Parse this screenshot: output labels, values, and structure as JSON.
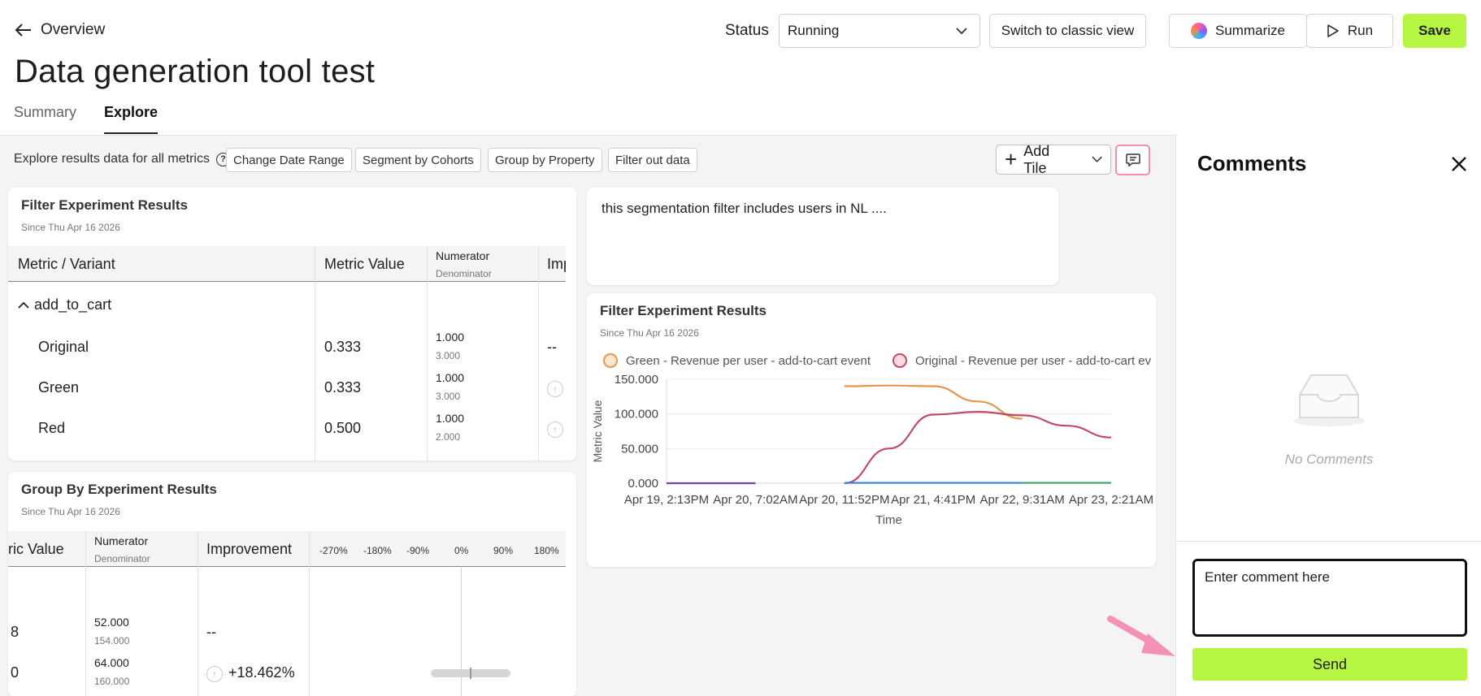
{
  "header": {
    "back_label": "Overview",
    "title": "Data generation tool test",
    "tabs": [
      {
        "label": "Summary"
      },
      {
        "label": "Explore"
      }
    ],
    "status_label": "Status",
    "status_value": "Running",
    "switch_label": "Switch to classic view",
    "summarize_label": "Summarize",
    "run_label": "Run",
    "save_label": "Save"
  },
  "toolbar": {
    "explore_text": "Explore results data for all metrics",
    "chips": [
      "Change Date Range",
      "Segment by Cohorts",
      "Group by Property",
      "Filter out data"
    ],
    "add_tile_label": "Add Tile"
  },
  "filter_table": {
    "title": "Filter Experiment Results",
    "since": "Since Thu Apr 16 2026",
    "headers": {
      "metric": "Metric / Variant",
      "value": "Metric Value",
      "numerator": "Numerator",
      "denominator": "Denominator",
      "improvement": "Imp"
    },
    "group": "add_to_cart",
    "rows": [
      {
        "variant": "Original",
        "value": "0.333",
        "num": "1.000",
        "den": "3.000",
        "imp": "--"
      },
      {
        "variant": "Green",
        "value": "0.333",
        "num": "1.000",
        "den": "3.000",
        "imp": ""
      },
      {
        "variant": "Red",
        "value": "0.500",
        "num": "1.000",
        "den": "2.000",
        "imp": ""
      }
    ]
  },
  "group_table": {
    "title": "Group By Experiment Results",
    "since": "Since Thu Apr 16 2026",
    "headers": {
      "value": "ric Value",
      "numerator": "Numerator",
      "denominator": "Denominator",
      "improvement": "Improvement"
    },
    "axis_ticks": [
      "-270%",
      "-180%",
      "-90%",
      "0%",
      "90%",
      "180%"
    ],
    "rows": [
      {
        "value": "8",
        "num": "52.000",
        "den": "154.000",
        "imp": "--"
      },
      {
        "value": "0",
        "num": "64.000",
        "den": "160.000",
        "imp": "+18.462%"
      }
    ]
  },
  "note": {
    "text": "this segmentation filter includes users in NL ...."
  },
  "chart_card": {
    "title": "Filter Experiment Results",
    "since": "Since Thu Apr 16 2026"
  },
  "chart_data": {
    "type": "line",
    "ylabel": "Metric Value",
    "xlabel": "Time",
    "ylim": [
      0,
      150
    ],
    "y_ticks": [
      "150.000",
      "100.000",
      "50.000",
      "0.000"
    ],
    "x_ticks": [
      "Apr 19, 2:13PM",
      "Apr 20, 7:02AM",
      "Apr 20, 11:52PM",
      "Apr 21, 4:41PM",
      "Apr 22, 9:31AM",
      "Apr 23, 2:21AM"
    ],
    "series": [
      {
        "name": "Green - Revenue per user - add-to-cart event",
        "color": "#e8954a",
        "points": [
          [
            2.0,
            140
          ],
          [
            2.5,
            141
          ],
          [
            3.0,
            140
          ],
          [
            3.5,
            118
          ],
          [
            4.0,
            93
          ]
        ]
      },
      {
        "name": "Original - Revenue per user - add-to-cart ev",
        "color": "#c24a64",
        "points": [
          [
            2.0,
            0
          ],
          [
            2.5,
            50
          ],
          [
            3.0,
            99
          ],
          [
            3.5,
            103
          ],
          [
            4.0,
            98
          ],
          [
            4.5,
            83
          ],
          [
            5.0,
            66
          ]
        ]
      },
      {
        "name": "",
        "color": "#7b3fa6",
        "points": [
          [
            0,
            0
          ],
          [
            1.0,
            0
          ]
        ]
      },
      {
        "name": "",
        "color": "#3a7fd5",
        "points": [
          [
            2.0,
            0.5
          ],
          [
            4.0,
            0.5
          ]
        ]
      },
      {
        "name": "",
        "color": "#3aa56a",
        "points": [
          [
            4.0,
            0.5
          ],
          [
            5.0,
            0.5
          ]
        ]
      }
    ]
  },
  "comments": {
    "title": "Comments",
    "empty_text": "No Comments",
    "placeholder": "Enter comment here",
    "send_label": "Send"
  }
}
